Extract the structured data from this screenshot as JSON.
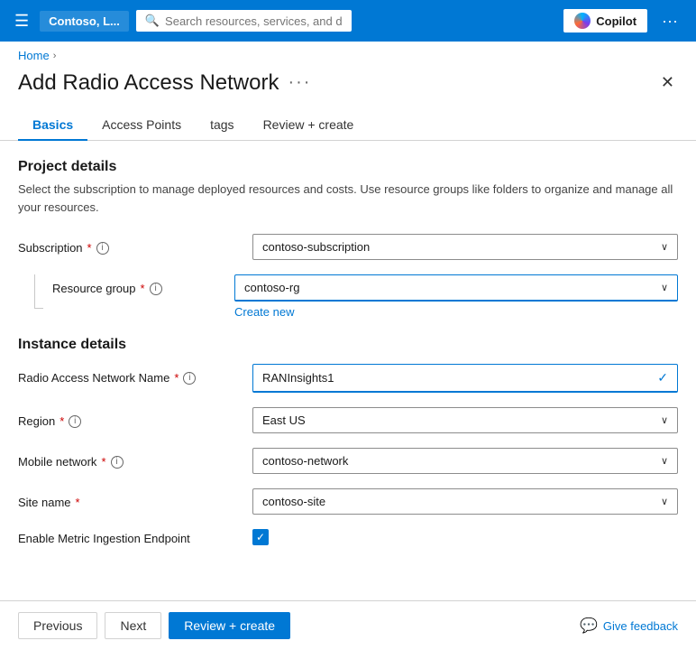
{
  "topBar": {
    "hamburger": "☰",
    "brand": "Contoso, L...",
    "searchPlaceholder": "Search resources, services, and docs (G+/)",
    "copilotLabel": "Copilot",
    "dotsLabel": "···"
  },
  "breadcrumb": {
    "home": "Home",
    "separator": "›"
  },
  "pageHeader": {
    "title": "Add Radio Access Network",
    "dotsLabel": "···",
    "closeLabel": "✕"
  },
  "tabs": [
    {
      "id": "basics",
      "label": "Basics",
      "active": true
    },
    {
      "id": "access-points",
      "label": "Access Points",
      "active": false
    },
    {
      "id": "tags",
      "label": "tags",
      "active": false
    },
    {
      "id": "review-create",
      "label": "Review + create",
      "active": false
    }
  ],
  "projectDetails": {
    "sectionTitle": "Project details",
    "sectionDesc": "Select the subscription to manage deployed resources and costs. Use resource groups like folders to organize and manage all your resources.",
    "subscriptionLabel": "Subscription",
    "subscriptionRequired": "*",
    "subscriptionValue": "contoso-subscription",
    "resourceGroupLabel": "Resource group",
    "resourceGroupRequired": "*",
    "resourceGroupValue": "contoso-rg",
    "createNewLabel": "Create new"
  },
  "instanceDetails": {
    "sectionTitle": "Instance details",
    "ranNameLabel": "Radio Access Network Name",
    "ranNameRequired": "*",
    "ranNameValue": "RANInsights1",
    "regionLabel": "Region",
    "regionRequired": "*",
    "regionValue": "East US",
    "mobileNetworkLabel": "Mobile network",
    "mobileNetworkRequired": "*",
    "mobileNetworkValue": "contoso-network",
    "siteNameLabel": "Site name",
    "siteNameRequired": "*",
    "siteNameValue": "contoso-site",
    "metricLabel": "Enable Metric Ingestion Endpoint",
    "metricChecked": true
  },
  "bottomBar": {
    "previousLabel": "Previous",
    "nextLabel": "Next",
    "reviewCreateLabel": "Review + create",
    "giveFeedbackLabel": "Give feedback",
    "giveFeedbackIcon": "💬"
  },
  "icons": {
    "search": "🔍",
    "dropdownArrow": "∨",
    "checkmark": "✓",
    "infoCircle": "i",
    "close": "✕"
  }
}
